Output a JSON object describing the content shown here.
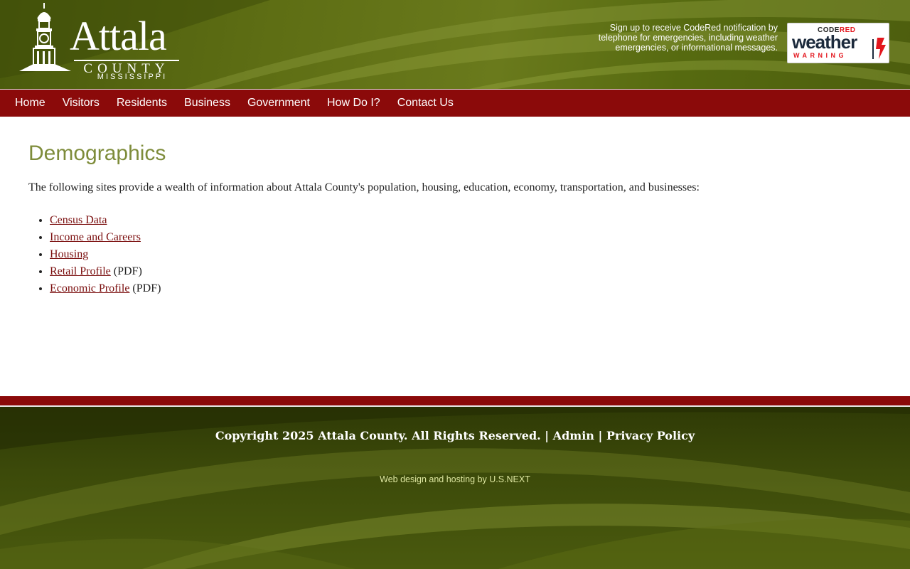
{
  "header": {
    "logo": {
      "title": "Attala",
      "county": "COUNTY",
      "state": "MISSISSIPPI"
    },
    "codered": {
      "text": "Sign up to receive CodeRed notification by telephone for emergencies, including weather emergencies, or informational messages.",
      "badge_top_black": "CODE",
      "badge_top_red": "RED",
      "badge_main": "weather",
      "badge_sub": "WARNING"
    }
  },
  "nav": {
    "items": [
      "Home",
      "Visitors",
      "Residents",
      "Business",
      "Government",
      "How Do I?",
      "Contact Us"
    ]
  },
  "main": {
    "title": "Demographics",
    "intro": "The following sites provide a wealth of information about Attala County's population, housing, education, economy, transportation, and businesses:",
    "links": [
      {
        "label": "Census Data",
        "suffix": ""
      },
      {
        "label": "Income and Careers",
        "suffix": ""
      },
      {
        "label": "Housing",
        "suffix": ""
      },
      {
        "label": "Retail Profile",
        "suffix": " (PDF)"
      },
      {
        "label": "Economic Profile",
        "suffix": " (PDF)"
      }
    ]
  },
  "footer": {
    "copyright": "Copyright 2025 Attala County. All Rights Reserved.",
    "separator": " | ",
    "admin": "Admin",
    "privacy": "Privacy Policy",
    "credit_prefix": "Web design and hosting by ",
    "credit_link": "U.S.NEXT"
  },
  "colors": {
    "nav_bg": "#8b0a0a",
    "title": "#7e8c3a",
    "link": "#7a0d0d",
    "header_green": "#5e6e14"
  }
}
